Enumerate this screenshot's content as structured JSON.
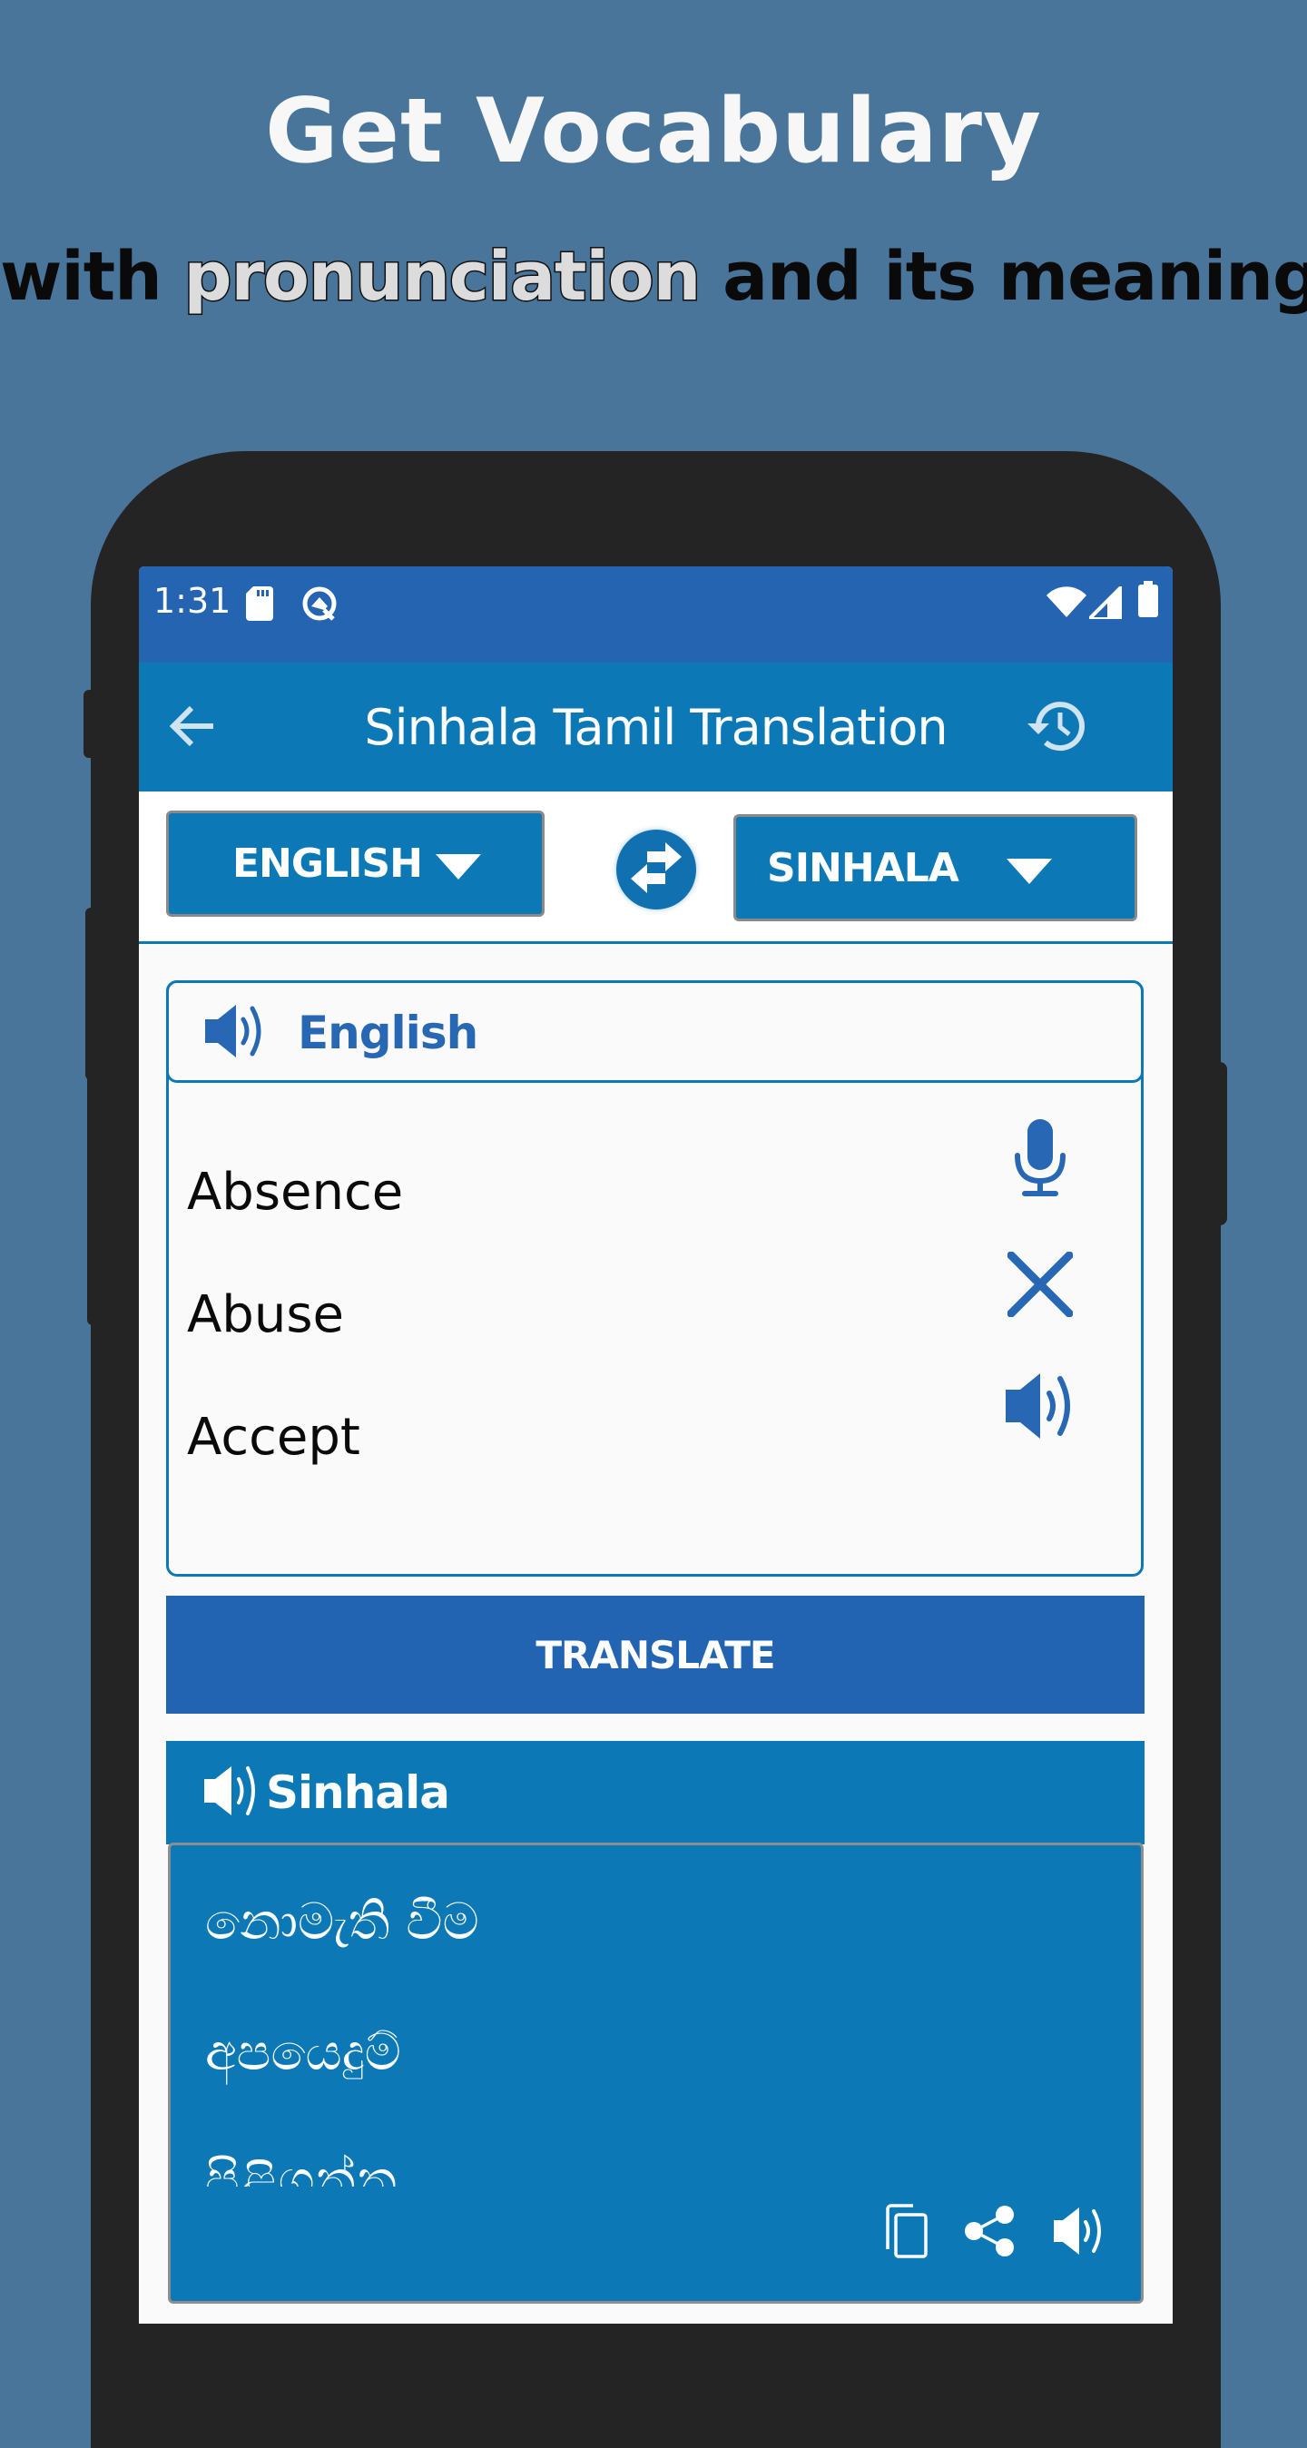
{
  "promo": {
    "headline": "Get Vocabulary",
    "subline_part1": "with ",
    "subline_highlight": "pronunciation",
    "subline_part2": " and its meaning"
  },
  "status_bar": {
    "time": "1:31",
    "left_icons": [
      "sd-card-icon",
      "data-saver-icon"
    ],
    "right_icons": [
      "wifi-icon",
      "signal-icon",
      "battery-icon"
    ]
  },
  "toolbar": {
    "title": "Sinhala Tamil Translation",
    "back_icon": "arrow-left-icon",
    "history_icon": "history-icon"
  },
  "language_selector": {
    "source_language": "ENGLISH",
    "target_language": "SINHALA",
    "swap_icon": "swap-arrows-icon"
  },
  "input_panel": {
    "header_label": "English",
    "words": [
      "Absence",
      "Abuse",
      "Accept"
    ],
    "actions": [
      "microphone-icon",
      "clear-icon",
      "speaker-icon"
    ]
  },
  "translate_button": {
    "label": "TRANSLATE"
  },
  "output_panel": {
    "header_label": "Sinhala",
    "words": [
      "නොමැති වීම",
      "අපයෙදුම්",
      "පිළිගන්න"
    ],
    "actions": [
      "copy-icon",
      "share-icon",
      "speaker-icon"
    ]
  },
  "colors": {
    "background": "#4a759b",
    "status_bar": "#2464b0",
    "primary": "#0c79b6",
    "translate_button": "#2364b2",
    "accent_text": "#2767b3",
    "phone_frame": "#242424"
  }
}
